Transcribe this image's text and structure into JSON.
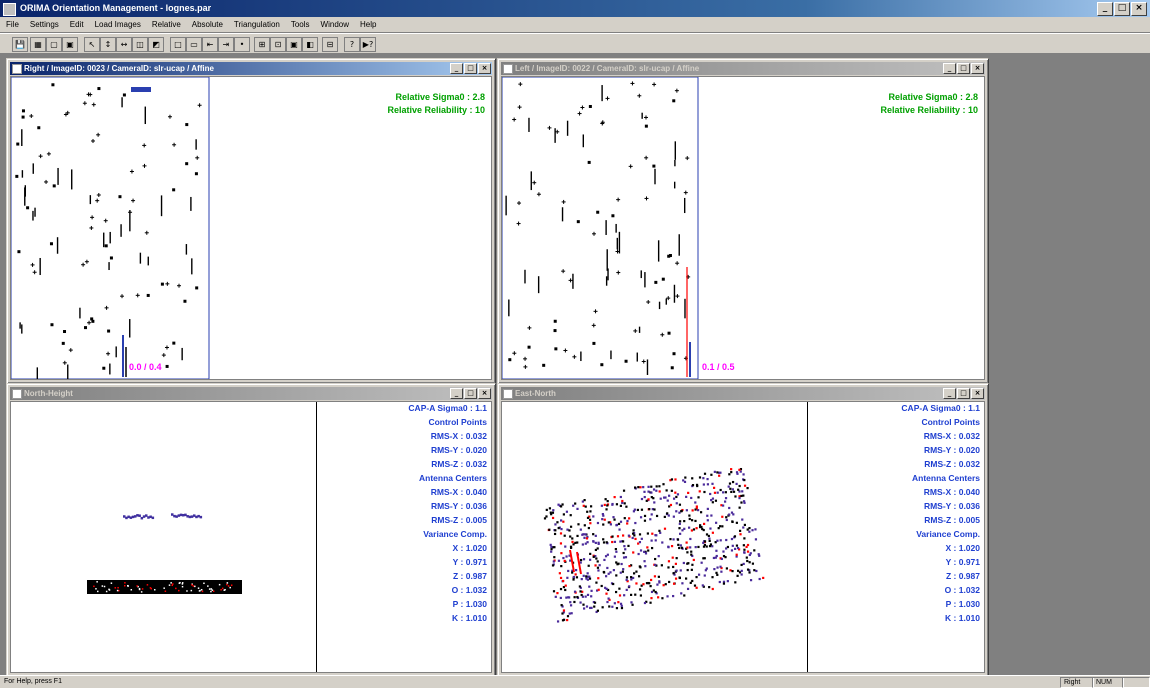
{
  "app": {
    "title": "ORIMA Orientation Management - lognes.par",
    "min": "_",
    "max": "□",
    "close": "×"
  },
  "menu": [
    "File",
    "Settings",
    "Edit",
    "Load Images",
    "Relative",
    "Absolute",
    "Triangulation",
    "Tools",
    "Window",
    "Help"
  ],
  "toolbar": [
    "💾",
    "▦",
    "▢",
    "▣",
    "↖",
    "↕",
    "↔",
    "◫",
    "◩",
    "□",
    "▭",
    "⇤",
    "⇥",
    "•",
    "⊞",
    "⊡",
    "▣",
    "◧",
    "⊟",
    "?",
    "▶?"
  ],
  "windows": {
    "right": {
      "title": "Right / ImageID: 0023 / CameraID: slr-ucap / Affine",
      "sigma": "Relative Sigma0 :  2.8",
      "reliability": "Relative Reliability :  10",
      "label": "0.0 /  0.4"
    },
    "left": {
      "title": "Left / ImageID: 0022 / CameraID: slr-ucap / Affine",
      "sigma": "Relative Sigma0 :  2.8",
      "reliability": "Relative Reliability :  10",
      "label": "0.1 /  0.5"
    },
    "north_height": {
      "title": "North-Height"
    },
    "east_north": {
      "title": "East-North"
    }
  },
  "rms": [
    "CAP-A Sigma0 :   1.1",
    "Control Points",
    "RMS-X :   0.032",
    "RMS-Y :   0.020",
    "RMS-Z :   0.032",
    "Antenna Centers",
    "RMS-X :   0.040",
    "RMS-Y :   0.036",
    "RMS-Z :   0.005",
    "Variance Comp.",
    "X :   1.020",
    "Y :   0.971",
    "Z :   0.987",
    "O :   1.032",
    "P :   1.030",
    "K :   1.010"
  ],
  "status": {
    "help": "For Help, press F1",
    "mode": "Right",
    "num": "NUM"
  },
  "colors": {
    "green": "#00a000",
    "blue": "#1f3fd0",
    "magenta": "#ff00ff"
  }
}
